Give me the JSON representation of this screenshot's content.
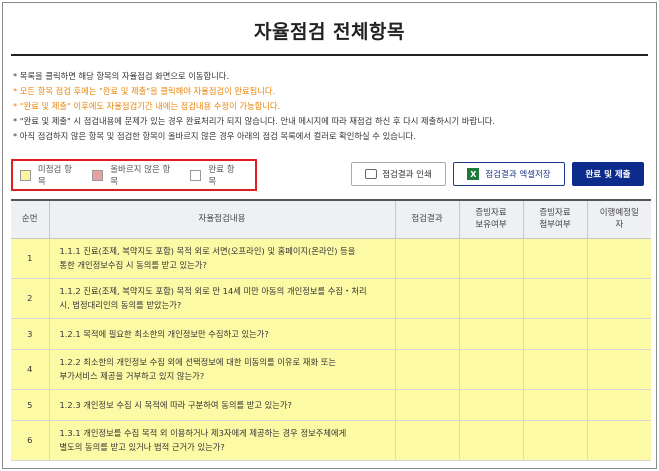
{
  "page": {
    "title": "자율점검 전체항목"
  },
  "notes": [
    {
      "text": "* 목록을 클릭하면 해당 항목의 자율점검 화면으로 이동합니다.",
      "color": "#333333"
    },
    {
      "text": "* 모든 항목 점검 후에는 \"완료 및 제출\"을 클릭해야 자율점검이 완료됩니다.",
      "color": "#e8850c"
    },
    {
      "text": "* \"완료 및 제출\" 이후에도 자율점검기간 내에는 점검내용 수정이 가능합니다.",
      "color": "#e8850c"
    },
    {
      "text": "* \"완료 및 제출\" 시 점검내용에 문제가 있는 경우 완료처리가 되지 않습니다. 안내 메시지에 따라 재점검 하신 후 다시 제출하시기 바랍니다.",
      "color": "#333333"
    },
    {
      "text": "* 아직 점검하지 않은 항목 및 점검한 항목이 올바르지 않은 경우 아래의 점검 목록에서 컬러로 확인하실 수 있습니다.",
      "color": "#333333"
    }
  ],
  "legend": [
    {
      "label": "미점검 항목",
      "color": "#fdf6a0"
    },
    {
      "label": "올바르지 않은 항목",
      "color": "#e8a0a0"
    },
    {
      "label": "완료 항목",
      "color": "#ffffff"
    }
  ],
  "buttons": {
    "print": "점검결과 인쇄",
    "excel": "점검결과 엑셀저장",
    "submit": "완료 및 제출"
  },
  "icons": {
    "print": "printer-icon",
    "excel": "excel-icon",
    "excel_glyph": "X"
  },
  "table": {
    "headers": [
      "순번",
      "자율점검내용",
      "점검결과",
      "증빙자료\n보유여부",
      "증빙자료\n첨부여부",
      "이행예정일\n자"
    ],
    "rows": [
      {
        "num": "1",
        "lines": [
          "1.1.1 진료(조제, 복약지도 포함) 목적 외로 서면(오프라인) 및 홈페이지(온라인) 등을",
          "통한 개인정보수집 시 동의를 받고 있는가?"
        ]
      },
      {
        "num": "2",
        "lines": [
          "1.1.2 진료(조제, 복약지도 포함) 목적 외로 만 14세 미만 아동의 개인정보를 수집・처리",
          "시, 법정대리인의 동의를 받았는가?"
        ]
      },
      {
        "num": "3",
        "lines": [
          "1.2.1 목적에 필요한 최소한의 개인정보만 수집하고 있는가?"
        ]
      },
      {
        "num": "4",
        "lines": [
          "1.2.2 최소한의 개인정보 수집 외에 선택정보에 대한 미동의를 이유로 재화 또는",
          "부가서비스 제공을 거부하고 있지 않는가?"
        ]
      },
      {
        "num": "5",
        "lines": [
          "1.2.3 개인정보 수집 시 목적에 따라 구분하여 동의를 받고 있는가?"
        ]
      },
      {
        "num": "6",
        "lines": [
          "1.3.1 개인정보를 수집 목적 외 이용하거나 제3자에게 제공하는 경우 정보주체에게",
          "별도의 동의를 받고 있거나 법적 근거가 있는가?"
        ]
      }
    ]
  },
  "colors": {
    "row_unchecked": "#fdfaa6",
    "submit_bg": "#0d2b8a",
    "legend_border": "#e02020"
  }
}
